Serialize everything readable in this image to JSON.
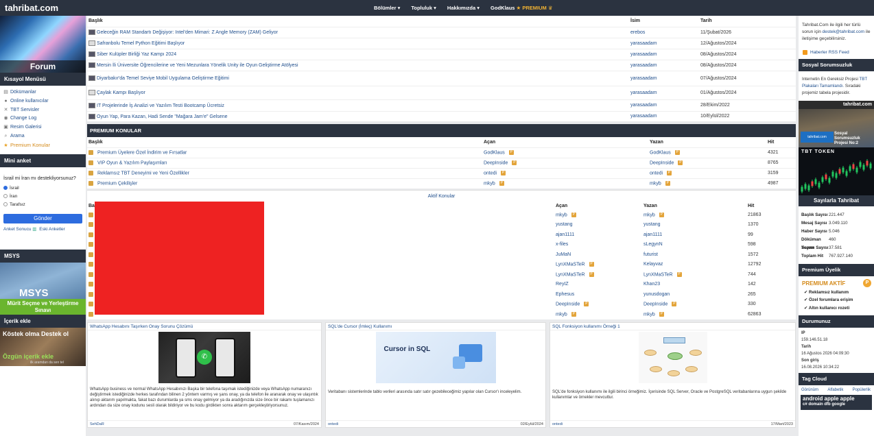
{
  "topbar": {
    "brand": "tahribat.com",
    "nav": [
      "Bölümler ▾",
      "Topluluk ▾",
      "Hakkımızda ▾"
    ],
    "user": "GodKlaus",
    "premium_label": "PREMIUM"
  },
  "left": {
    "forum_label": "Forum",
    "menu_title": "Kısayol Menüsü",
    "menu": [
      {
        "icon": "document-icon",
        "label": "Dökümanlar"
      },
      {
        "icon": "users-icon",
        "label": "Online kullanıcılar"
      },
      {
        "icon": "tools-icon",
        "label": "TBT Servisler"
      },
      {
        "icon": "changelog-icon",
        "label": "Change Log"
      },
      {
        "icon": "gallery-icon",
        "label": "Resim Galerisi"
      },
      {
        "icon": "search-icon",
        "label": "Arama"
      },
      {
        "icon": "star-icon",
        "label": "Premium Konular"
      }
    ],
    "poll_title": "Mini anket",
    "poll_question": "İsrail mi İran mı destekliyorsunuz?",
    "poll_options": [
      "İsrail",
      "İran",
      "Tarafsız"
    ],
    "poll_button": "Gönder",
    "poll_results": "Anket Sonucu",
    "poll_old": "Eski Anketler",
    "msys_title": "MSYS",
    "msys_img_text": "MSYS",
    "msys_band": "Mürit Seçme ve Yerleştirme Sınavı",
    "icerik_title": "İçerik ekle",
    "icerik_t1": "Köstek olma Destek ol",
    "icerik_t2": "Özgün içerik ekle",
    "icerik_t3": "ilk aramdan da sen tel"
  },
  "news": {
    "headers": {
      "title": "Başlık",
      "name": "İsim",
      "date": "Tarih"
    },
    "rows": [
      {
        "title": "Geleceğin RAM Standartı Değişiyor: Intel'den Mimari: Z Angle Memory (ZAM) Geliyor",
        "name": "erebos",
        "date": "11/Şubat/2026"
      },
      {
        "title": "Safranbolu Temel Python Eğitimi Başlıyor",
        "name": "yarasaadam",
        "date": "12/Ağustos/2024"
      },
      {
        "title": "Siber Kulüpler Birliği Yaz Kampı 2024",
        "name": "yarasaadam",
        "date": "08/Ağustos/2024"
      },
      {
        "title": "Mersin İli Üniversite Öğrencilerine ve Yeni Mezunlara Yönelik Unity ile Oyun Geliştirme Atölyesi",
        "name": "yarasaadam",
        "date": "08/Ağustos/2024"
      },
      {
        "title": "Diyarbakır'da Temel Seviye Mobil Uygulama Geliştirme Eğitimi",
        "name": "yarasaadam",
        "date": "07/Ağustos/2024"
      },
      {
        "title": "Çaylak Kampı Başlıyor",
        "name": "yarasaadam",
        "date": "01/Ağustos/2024"
      },
      {
        "title": "IT Projelerinde İş Analizi ve Yazılım Testi Bootcamp Ücretsiz",
        "name": "yarasaadam",
        "date": "28/Ekim/2022"
      },
      {
        "title": "Oyun Yap, Para Kazan, Hadi Sende \"Mağara Jam'e\" Gelsene",
        "name": "yarasaadam",
        "date": "10/Eylül/2022"
      }
    ]
  },
  "premium": {
    "title": "PREMIUM KONULAR",
    "headers": {
      "title": "Başlık",
      "acan": "Açan",
      "yazan": "Yazan",
      "hit": "Hit"
    },
    "rows": [
      {
        "title": "Premium Üyelere Özel İndirim ve Fırsatlar",
        "acan": "GodKlaus",
        "yazan": "GodKlaus",
        "hit": "4321"
      },
      {
        "title": "VIP Oyun & Yazılım Paylaşımları",
        "acan": "DeepInside",
        "yazan": "DeepInside",
        "hit": "8765"
      },
      {
        "title": "Reklamsız TBT Deneyimi ve Yeni Özellikler",
        "acan": "ontedi",
        "yazan": "ontedi",
        "hit": "3159"
      },
      {
        "title": "Premium Çekilişler",
        "acan": "mkyb",
        "yazan": "mkyb",
        "hit": "4987"
      }
    ]
  },
  "aktif": {
    "title": "Aktif Konular",
    "headers": {
      "title": "Başlık",
      "acan": "Açan",
      "yazan": "Yazan",
      "hit": "Hit"
    },
    "rows": [
      {
        "acan": "mkyb",
        "acan_p": true,
        "yazan": "mkyb",
        "yazan_p": true,
        "hit": "21863"
      },
      {
        "acan": "yustang",
        "acan_p": false,
        "yazan": "yustang",
        "yazan_p": false,
        "hit": "1370"
      },
      {
        "acan": "ajan1111",
        "acan_p": false,
        "yazan": "ajan1111",
        "yazan_p": false,
        "hit": "99"
      },
      {
        "acan": "x-files",
        "acan_p": false,
        "yazan": "sLegynN",
        "yazan_p": false,
        "hit": "598"
      },
      {
        "acan": "JuMaN",
        "acan_p": false,
        "yazan": "futurist",
        "yazan_p": false,
        "hit": "1572"
      },
      {
        "acan": "LynXMaSTeR",
        "acan_p": true,
        "yazan": "Kelayvaz",
        "yazan_p": false,
        "hit": "12792"
      },
      {
        "acan": "LynXMaSTeR",
        "acan_p": true,
        "yazan": "LynXMaSTeR",
        "yazan_p": true,
        "hit": "744"
      },
      {
        "acan": "ReyIZ",
        "acan_p": false,
        "yazan": "Khan23",
        "yazan_p": false,
        "hit": "142"
      },
      {
        "acan": "Ephesus",
        "acan_p": false,
        "yazan": "yunusdogan",
        "yazan_p": false,
        "hit": "265"
      },
      {
        "acan": "DeepInside",
        "acan_p": true,
        "yazan": "DeepInside",
        "yazan_p": true,
        "hit": "330"
      },
      {
        "acan": "mkyb",
        "acan_p": true,
        "yazan": "mkyb",
        "yazan_p": true,
        "hit": "62863"
      }
    ]
  },
  "cards": [
    {
      "title": "WhatsApp Hesabını Taşırken Onay Sorunu Çözümü",
      "desc": "WhatsApp business ve normal WhatsApp Hesabınızı Başka bir telefona taşımak istediğinizde veya WhatsApp numaranızı değiştirmek istediğinizde herkes tarafından bilinen 2 yöntem varmış ve şans onay, ya da telefon ile aranarak onay ve ulaşıntık alınıp aktarım yapılmakta, fakat bazı durumlarda ya sms onay gelmiyor ya da aradığınızda size önce bir rakamı tuşlamanızı ardından da size onay kodunu sesli olarak bildiriyor ve bu kodu girdikten sonra aktarım gerçekleştiriyorsunuz.",
      "author": "SehDaR",
      "date": "07/Kasım/2024"
    },
    {
      "title": "SQL'de Cursor (İmleç) Kullanımı",
      "img_text": "Cursor in SQL",
      "desc": "Veritabanı sistemlerinde tablo verileri arasında satır satır gezebileceğimiz yapılar olan Cursor'ı inceleyelim.",
      "author": "ontedi",
      "date": "02/Eylül/2024"
    },
    {
      "title": "SQL Fonksiyon kullanımı Örneği 1",
      "desc": "SQL'de fonksiyon kullanımı ile ilgili birinci örneğimiz. İçerisinde SQL Server, Oracle ve PostgreSQL veritabanlarına uygun şekilde kullanımlar ve örnekler mevcuttur.",
      "author": "ontedi",
      "date": "17/Mart/2023"
    }
  ],
  "right": {
    "info_pre": "Tahribat.Com ile ilgili her türlü sorun için",
    "info_email": "destek@tahribat.com",
    "info_post": "ile iletişime geçebilirsiniz.",
    "rss": "Haberler RSS Feed",
    "sosyal_title": "Sosyal Sorumsuzluk",
    "sosyal_pre": "Internetin En Gereksiz Projesi",
    "sosyal_link": "TBT Plakaları Tamamlandı.",
    "sosyal_post": "Sıradaki projemiz tabela projesidir.",
    "ad1_top": "tahribat.com",
    "ad1_blue": "tahribat.com",
    "ad1_text": "Sosyal Sorumsuzluk Projesi No:2",
    "ad2_title": "TBT TOKEN",
    "ad2_band": "Sayılarla Tahribat",
    "stats": [
      {
        "label": "Başlık Sayısı",
        "value": "221.447"
      },
      {
        "label": "Mesaj Sayısı",
        "value": "3.049.110"
      },
      {
        "label": "Haber Sayısı",
        "value": "5.046"
      },
      {
        "label": "Döküman Sayısı",
        "value": "460"
      },
      {
        "label": "Yorum Sayısı",
        "value": "37.581"
      },
      {
        "label": "Toplam Hit",
        "value": "767.927.140"
      }
    ],
    "prem_title": "Premium Üyelik",
    "prem_active": "PREMIUM AKTİF",
    "prem_coin": "P",
    "prem_features": [
      "Reklamsız kullanım",
      "Özel forumlara erişim",
      "Altın kullanıcı rozeti"
    ],
    "durum_title": "Durumunuz",
    "ip_label": "IP",
    "ip": "159.146.51.18",
    "tarih_label": "Tarih",
    "tarih": "16 Ağustos 2026 04:09:30",
    "son_label": "Son giriş",
    "son": "16.08.2026 10:34:22",
    "tag_title": "Tag Cloud",
    "tag_tabs": [
      "Görünüm",
      "Alfabetik",
      "Popülerlik"
    ],
    "tagcloud_line1": "android apple apple",
    "tagcloud_line2": "c# domain dfb google"
  }
}
